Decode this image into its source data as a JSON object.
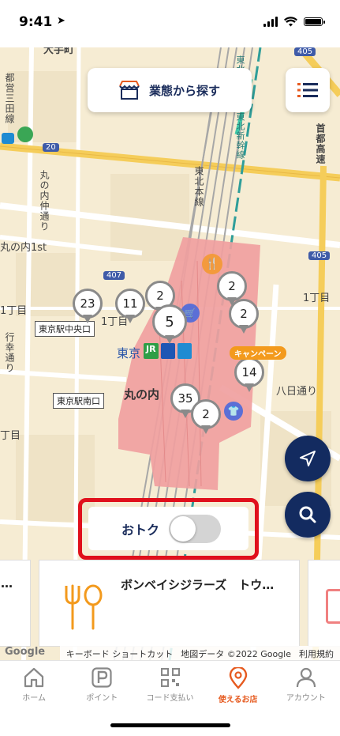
{
  "status": {
    "time": "9:41"
  },
  "header": {
    "category_search_label": "業態から探す"
  },
  "map": {
    "texts": {
      "otemachi": "大手町",
      "mita_line": "都営三田線",
      "marunouchi_dori": "丸の内仲通り",
      "marunouchi_1st": "丸の内1st",
      "ichome_left": "1丁目",
      "ichome_center": "1丁目",
      "ichome_right": "1丁目",
      "chome_bottom": "丁目",
      "gyoko_dori": "行幸通り",
      "tokyo": "東京",
      "marunouchi": "丸の内",
      "yaesu_dori": "八日通り",
      "tohoku_line": "東北本線",
      "shinkansen": "東北新幹線・東北新幹線",
      "shuto_expressway": "首都高速"
    },
    "route_badges": [
      "20",
      "407",
      "405",
      "405"
    ],
    "station_labels": [
      "東京駅中央口",
      "東京駅南口"
    ],
    "clusters": [
      {
        "count": "23"
      },
      {
        "count": "11"
      },
      {
        "count": "2"
      },
      {
        "count": "5"
      },
      {
        "count": "2"
      },
      {
        "count": "2"
      },
      {
        "count": "14"
      },
      {
        "count": "35"
      },
      {
        "count": "2"
      }
    ],
    "campaign_label": "キャンペーン"
  },
  "otoku": {
    "label": "おトク",
    "enabled": false
  },
  "cards": [
    {
      "name": "…"
    },
    {
      "name": "ボンベイシジラーズ　トウ…"
    }
  ],
  "attribution": {
    "shortcuts": "キーボード ショートカット",
    "map_data": "地図データ ©2022 Google",
    "terms": "利用規約",
    "google": "Google"
  },
  "tabs": [
    {
      "label": "ホーム",
      "icon": "home-icon",
      "active": false
    },
    {
      "label": "ポイント",
      "icon": "point-icon",
      "active": false
    },
    {
      "label": "コード支払い",
      "icon": "qr-code-icon",
      "active": false
    },
    {
      "label": "使えるお店",
      "icon": "map-pin-icon",
      "active": true
    },
    {
      "label": "アカウント",
      "icon": "account-icon",
      "active": false
    }
  ],
  "colors": {
    "navy": "#132b60",
    "accent": "#e65a1f",
    "highlight": "#e0101c",
    "station": "#f0a0a0"
  }
}
